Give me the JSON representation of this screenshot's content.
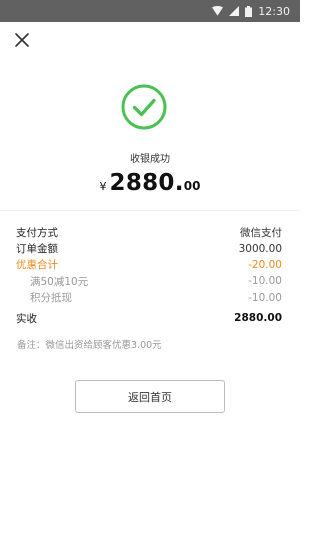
{
  "status_bar": {
    "time": "12:30",
    "icons": [
      "wifi-icon",
      "signal-icon",
      "battery-icon"
    ]
  },
  "header": {
    "close_icon": "close-icon"
  },
  "result": {
    "icon": "success-check-icon",
    "status_text": "收银成功",
    "currency": "¥",
    "amount_main": "2880.",
    "amount_decimal": "00",
    "accent_color": "#4cc153"
  },
  "details": {
    "payment_method_label": "支付方式",
    "payment_method_value": "微信支付",
    "order_amount_label": "订单金额",
    "order_amount_value": "3000.00",
    "discount_total_label": "优惠合计",
    "discount_total_value": "-20.00",
    "discount_color": "#f08a24",
    "items": [
      {
        "label": "满50减10元",
        "value": "-10.00"
      },
      {
        "label": "积分抵现",
        "value": "-10.00"
      }
    ],
    "received_label": "实收",
    "received_value": "2880.00"
  },
  "remark": "备注：微信出资给顾客优惠3.00元",
  "actions": {
    "home_button_label": "返回首页"
  }
}
